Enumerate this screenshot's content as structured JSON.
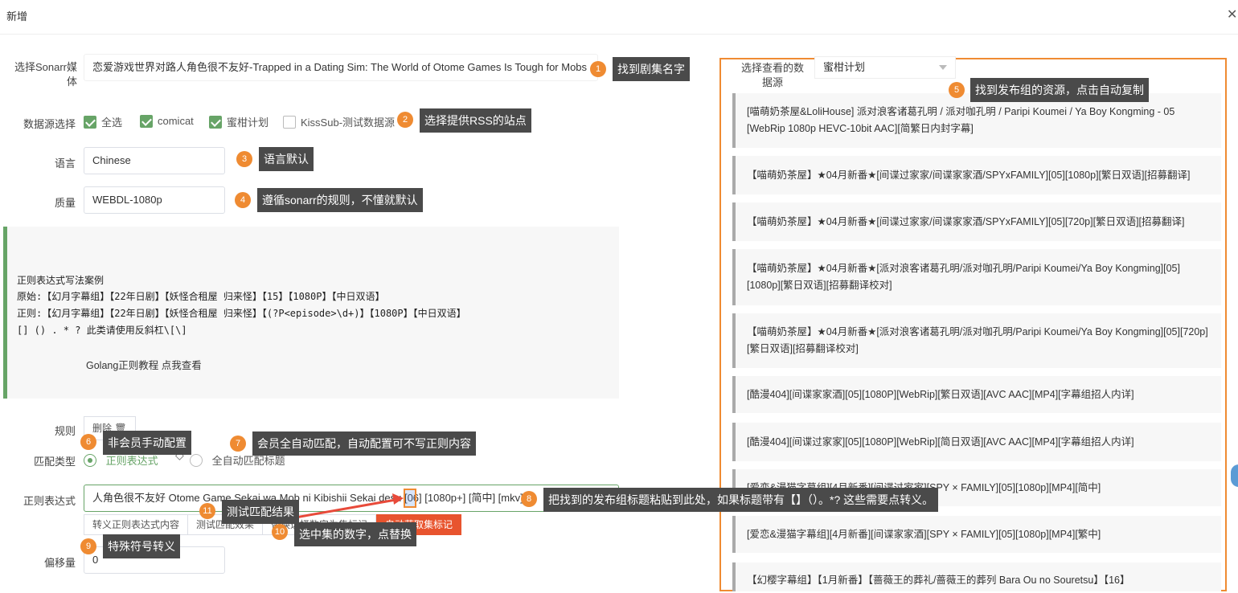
{
  "dialog": {
    "title": "新增",
    "close": "✕"
  },
  "form": {
    "sonarr_label": "选择Sonarr媒体",
    "sonarr_value": "恋爱游戏世界对路人角色很不友好-Trapped in a Dating Sim: The World of Otome Games Is Tough for Mobs",
    "source_label": "数据源选择",
    "sources": [
      {
        "label": "全选",
        "checked": true
      },
      {
        "label": "comicat",
        "checked": true
      },
      {
        "label": "蜜柑计划",
        "checked": true
      },
      {
        "label": "KissSub-测试数据源",
        "checked": false
      }
    ],
    "lang_label": "语言",
    "lang_value": "Chinese",
    "quality_label": "质量",
    "quality_value": "WEBDL-1080p",
    "hint": {
      "line1": "正则表达式写法案例",
      "line2": "原始:【幻月字幕组】【22年日剧】【妖怪合租屋 归来怪】【15】【1080P】【中日双语】",
      "line3": "正则:【幻月字幕组】【22年日剧】【妖怪合租屋 归来怪】【(?P<episode>\\d+)】【1080P】【中日双语】",
      "line4": "[] () . * ? 此类请使用反斜杠\\[\\]",
      "link": "Golang正则教程 点我查看"
    },
    "rule_label": "规则",
    "delete_label": "删除",
    "match_label": "匹配类型",
    "match_regex": "正则表达式",
    "match_auto": "全自动匹配标题",
    "regex_label": "正则表达式",
    "regex_value": "人角色很不友好 Otome Game Sekai wa Mob ni Kibishii Sekai desu [06] [1080p+] [简中] [mkv]",
    "btn_escape": "转义正则表达式内容",
    "btn_test": "测试匹配效果",
    "btn_replace": "替换选择数字为集标记",
    "btn_auto": "自动获取集标记",
    "offset_label": "偏移量",
    "offset_value": "0"
  },
  "annotations": [
    {
      "num": "1",
      "text": "找到剧集名字"
    },
    {
      "num": "2",
      "text": "选择提供RSS的站点"
    },
    {
      "num": "3",
      "text": "语言默认"
    },
    {
      "num": "4",
      "text": "遵循sonarr的规则，不懂就默认"
    },
    {
      "num": "5",
      "text": "找到发布组的资源，点击自动复制"
    },
    {
      "num": "6",
      "text": "非会员手动配置"
    },
    {
      "num": "7",
      "text": "会员全自动匹配，自动配置可不写正则内容"
    },
    {
      "num": "8",
      "text": "把找到的发布组标题粘贴到此处，如果标题带有【】（）。*? 这些需要点转义。"
    },
    {
      "num": "9",
      "text": "特殊符号转义"
    },
    {
      "num": "10",
      "text": "选中集的数字，点替换"
    },
    {
      "num": "11",
      "text": "测试匹配结果"
    }
  ],
  "right_panel": {
    "select_label": "选择查看的数据源",
    "select_value": "蜜柑计划",
    "items": [
      "[喵萌奶茶屋&LoliHouse] 派对浪客诸葛孔明 / 派对咖孔明 / Paripi Koumei / Ya Boy Kongming - 05 [WebRip 1080p HEVC-10bit AAC][简繁日内封字幕]",
      "【喵萌奶茶屋】★04月新番★[间谍过家家/间谍家家酒/SPYxFAMILY][05][1080p][繁日双语][招募翻译]",
      "【喵萌奶茶屋】★04月新番★[间谍过家家/间谍家家酒/SPYxFAMILY][05][720p][繁日双语][招募翻译]",
      "【喵萌奶茶屋】★04月新番★[派对浪客诸葛孔明/派对咖孔明/Paripi Koumei/Ya Boy Kongming][05][1080p][繁日双语][招募翻译校对]",
      "【喵萌奶茶屋】★04月新番★[派对浪客诸葛孔明/派对咖孔明/Paripi Koumei/Ya Boy Kongming][05][720p][繁日双语][招募翻译校对]",
      "[酷漫404][间谍家家酒][05][1080P][WebRip][繁日双语][AVC AAC][MP4][字幕组招人内详]",
      "[酷漫404][间谍过家家][05][1080P][WebRip][简日双语][AVC AAC][MP4][字幕组招人内详]",
      "[爱恋&漫猫字幕组][4月新番][间谍过家家][SPY × FAMILY][05][1080p][MP4][简中]",
      "[爱恋&漫猫字幕组][4月新番][间谍家家酒][SPY × FAMILY][05][1080p][MP4][繁中]",
      "【幻樱字幕组】【1月新番】【蔷薇王的葬礼/蔷薇王的葬列 Bara Ou no Souretsu】【16】"
    ]
  },
  "colors": {
    "accent_green": "#67a467",
    "annotation_orange": "#ef8b32",
    "tooltip_bg": "#4a4a4a",
    "arrow_red": "#e84a3a"
  }
}
